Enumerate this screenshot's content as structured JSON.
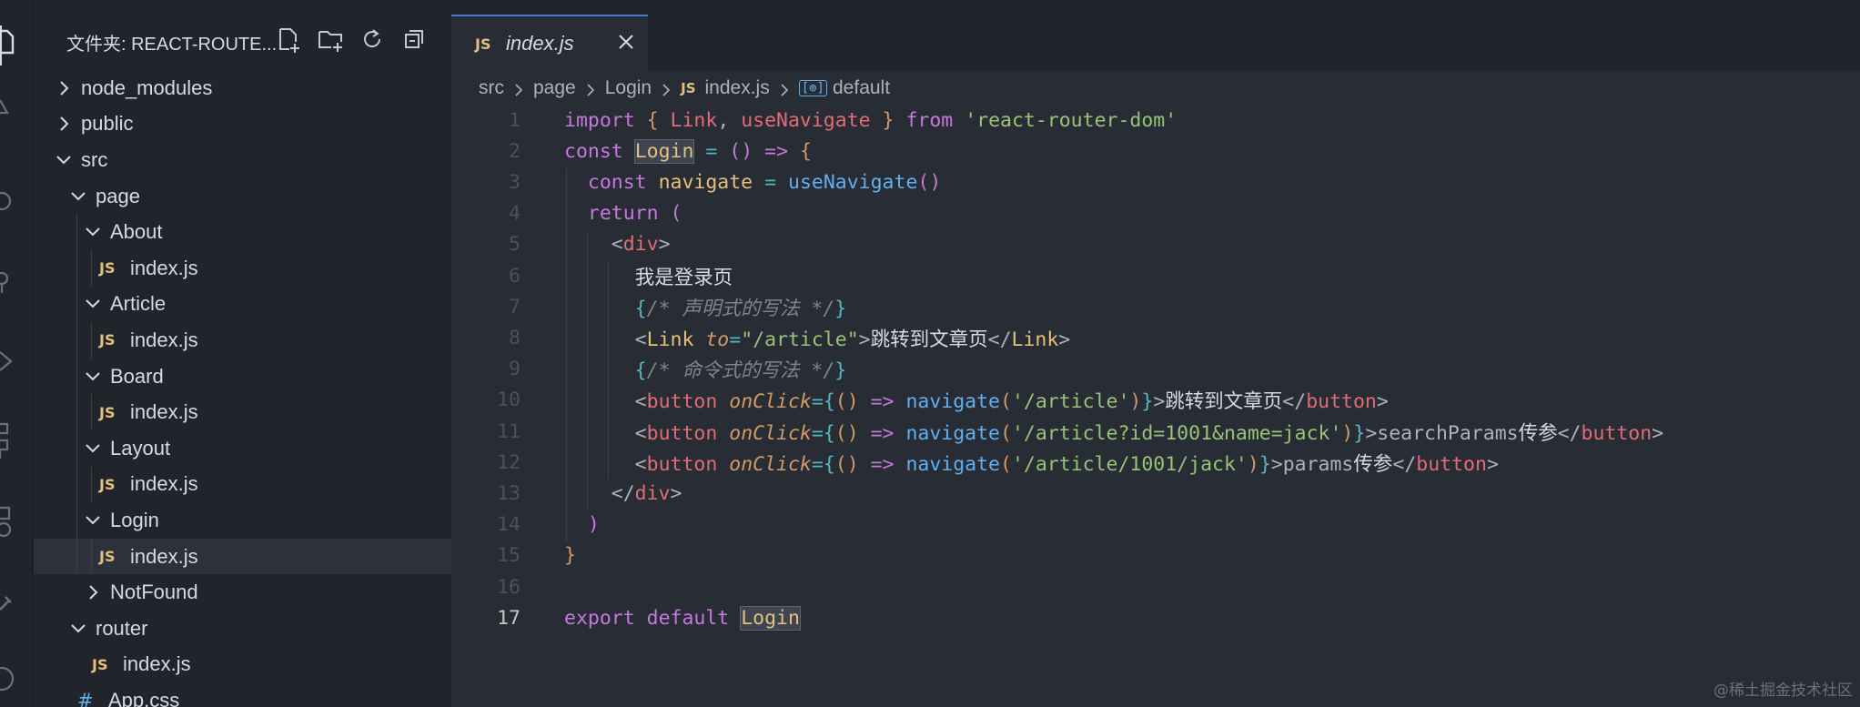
{
  "explorer": {
    "title": "文件夹: REACT-ROUTE...",
    "tree": [
      {
        "label": "node_modules",
        "kind": "folder",
        "expanded": false,
        "depth": 0
      },
      {
        "label": "public",
        "kind": "folder",
        "expanded": false,
        "depth": 0
      },
      {
        "label": "src",
        "kind": "folder",
        "expanded": true,
        "depth": 0
      },
      {
        "label": "page",
        "kind": "folder",
        "expanded": true,
        "depth": 1
      },
      {
        "label": "About",
        "kind": "folder",
        "expanded": true,
        "depth": 2
      },
      {
        "label": "index.js",
        "kind": "js",
        "depth": 3
      },
      {
        "label": "Article",
        "kind": "folder",
        "expanded": true,
        "depth": 2
      },
      {
        "label": "index.js",
        "kind": "js",
        "depth": 3
      },
      {
        "label": "Board",
        "kind": "folder",
        "expanded": true,
        "depth": 2
      },
      {
        "label": "index.js",
        "kind": "js",
        "depth": 3
      },
      {
        "label": "Layout",
        "kind": "folder",
        "expanded": true,
        "depth": 2
      },
      {
        "label": "index.js",
        "kind": "js",
        "depth": 3
      },
      {
        "label": "Login",
        "kind": "folder",
        "expanded": true,
        "depth": 2
      },
      {
        "label": "index.js",
        "kind": "js",
        "depth": 3,
        "selected": true
      },
      {
        "label": "NotFound",
        "kind": "folder",
        "expanded": false,
        "depth": 2
      },
      {
        "label": "router",
        "kind": "folder",
        "expanded": true,
        "depth": 1
      },
      {
        "label": "index.js",
        "kind": "js",
        "depth": 2
      },
      {
        "label": "App.css",
        "kind": "css",
        "depth": 1
      }
    ]
  },
  "tab": {
    "badge": "JS",
    "label": "index.js"
  },
  "breadcrumb": [
    "src",
    "page",
    "Login",
    "index.js",
    "default"
  ],
  "colors": {
    "accent": "#4d78cc",
    "keyword": "#c678dd",
    "string": "#98c379",
    "function": "#61afef",
    "variable": "#e06c75"
  },
  "code": {
    "active_line": 17,
    "lines": [
      [
        [
          "k",
          "import"
        ],
        [
          "p",
          " "
        ],
        [
          "b1",
          "{"
        ],
        [
          "p",
          " "
        ],
        [
          "v",
          "Link"
        ],
        [
          "p",
          ", "
        ],
        [
          "v",
          "useNavigate"
        ],
        [
          "p",
          " "
        ],
        [
          "b1",
          "}"
        ],
        [
          "p",
          " "
        ],
        [
          "k",
          "from"
        ],
        [
          "p",
          " "
        ],
        [
          "s",
          "'react-router-dom'"
        ]
      ],
      [
        [
          "k",
          "const"
        ],
        [
          "p",
          " "
        ],
        [
          "nvh",
          "Login"
        ],
        [
          "p",
          " "
        ],
        [
          "o",
          "="
        ],
        [
          "p",
          " "
        ],
        [
          "b2",
          "()"
        ],
        [
          "p",
          " "
        ],
        [
          "k",
          "=>"
        ],
        [
          "p",
          " "
        ],
        [
          "b1",
          "{"
        ]
      ],
      [
        [
          "p",
          "  "
        ],
        [
          "k",
          "const"
        ],
        [
          "p",
          " "
        ],
        [
          "nv",
          "navigate"
        ],
        [
          "p",
          " "
        ],
        [
          "o",
          "="
        ],
        [
          "p",
          " "
        ],
        [
          "f",
          "useNavigate"
        ],
        [
          "b2",
          "()"
        ]
      ],
      [
        [
          "p",
          "  "
        ],
        [
          "k",
          "return"
        ],
        [
          "p",
          " "
        ],
        [
          "b2",
          "("
        ]
      ],
      [
        [
          "p",
          "    "
        ],
        [
          "p",
          "<"
        ],
        [
          "t",
          "div"
        ],
        [
          "p",
          ">"
        ]
      ],
      [
        [
          "p",
          "      "
        ],
        [
          "txt",
          "我是登录页"
        ]
      ],
      [
        [
          "p",
          "      "
        ],
        [
          "b3",
          "{"
        ],
        [
          "c",
          "/* 声明式的写法 */"
        ],
        [
          "b3",
          "}"
        ]
      ],
      [
        [
          "p",
          "      "
        ],
        [
          "p",
          "<"
        ],
        [
          "tc",
          "Link"
        ],
        [
          "p",
          " "
        ],
        [
          "a",
          "to"
        ],
        [
          "o",
          "="
        ],
        [
          "s",
          "\"/article\""
        ],
        [
          "p",
          ">"
        ],
        [
          "txt",
          "跳转到文章页"
        ],
        [
          "p",
          "</"
        ],
        [
          "tc",
          "Link"
        ],
        [
          "p",
          ">"
        ]
      ],
      [
        [
          "p",
          "      "
        ],
        [
          "b3",
          "{"
        ],
        [
          "c",
          "/* 命令式的写法 */"
        ],
        [
          "b3",
          "}"
        ]
      ],
      [
        [
          "p",
          "      "
        ],
        [
          "p",
          "<"
        ],
        [
          "t",
          "button"
        ],
        [
          "p",
          " "
        ],
        [
          "a",
          "onClick"
        ],
        [
          "o",
          "="
        ],
        [
          "b3",
          "{"
        ],
        [
          "b1",
          "()"
        ],
        [
          "p",
          " "
        ],
        [
          "k",
          "=>"
        ],
        [
          "p",
          " "
        ],
        [
          "f",
          "navigate"
        ],
        [
          "b1",
          "("
        ],
        [
          "s",
          "'/article'"
        ],
        [
          "b1",
          ")"
        ],
        [
          "b3",
          "}"
        ],
        [
          "p",
          ">"
        ],
        [
          "txt",
          "跳转到文章页"
        ],
        [
          "p",
          "</"
        ],
        [
          "t",
          "button"
        ],
        [
          "p",
          ">"
        ]
      ],
      [
        [
          "p",
          "      "
        ],
        [
          "p",
          "<"
        ],
        [
          "t",
          "button"
        ],
        [
          "p",
          " "
        ],
        [
          "a",
          "onClick"
        ],
        [
          "o",
          "="
        ],
        [
          "b3",
          "{"
        ],
        [
          "b1",
          "()"
        ],
        [
          "p",
          " "
        ],
        [
          "k",
          "=>"
        ],
        [
          "p",
          " "
        ],
        [
          "f",
          "navigate"
        ],
        [
          "b1",
          "("
        ],
        [
          "s",
          "'/article?id=1001&name=jack'"
        ],
        [
          "b1",
          ")"
        ],
        [
          "b3",
          "}"
        ],
        [
          "p",
          ">searchParams"
        ],
        [
          "txt",
          "传参"
        ],
        [
          "p",
          "</"
        ],
        [
          "t",
          "button"
        ],
        [
          "p",
          ">"
        ]
      ],
      [
        [
          "p",
          "      "
        ],
        [
          "p",
          "<"
        ],
        [
          "t",
          "button"
        ],
        [
          "p",
          " "
        ],
        [
          "a",
          "onClick"
        ],
        [
          "o",
          "="
        ],
        [
          "b3",
          "{"
        ],
        [
          "b1",
          "()"
        ],
        [
          "p",
          " "
        ],
        [
          "k",
          "=>"
        ],
        [
          "p",
          " "
        ],
        [
          "f",
          "navigate"
        ],
        [
          "b1",
          "("
        ],
        [
          "s",
          "'/article/1001/jack'"
        ],
        [
          "b1",
          ")"
        ],
        [
          "b3",
          "}"
        ],
        [
          "p",
          ">params"
        ],
        [
          "txt",
          "传参"
        ],
        [
          "p",
          "</"
        ],
        [
          "t",
          "button"
        ],
        [
          "p",
          ">"
        ]
      ],
      [
        [
          "p",
          "    "
        ],
        [
          "p",
          "</"
        ],
        [
          "t",
          "div"
        ],
        [
          "p",
          ">"
        ]
      ],
      [
        [
          "p",
          "  "
        ],
        [
          "b2",
          ")"
        ]
      ],
      [
        [
          "b1",
          "}"
        ]
      ],
      [],
      [
        [
          "k",
          "export"
        ],
        [
          "p",
          " "
        ],
        [
          "k",
          "default"
        ],
        [
          "p",
          " "
        ],
        [
          "nvh",
          "Login"
        ]
      ]
    ]
  },
  "watermark": "@稀土掘金技术社区"
}
